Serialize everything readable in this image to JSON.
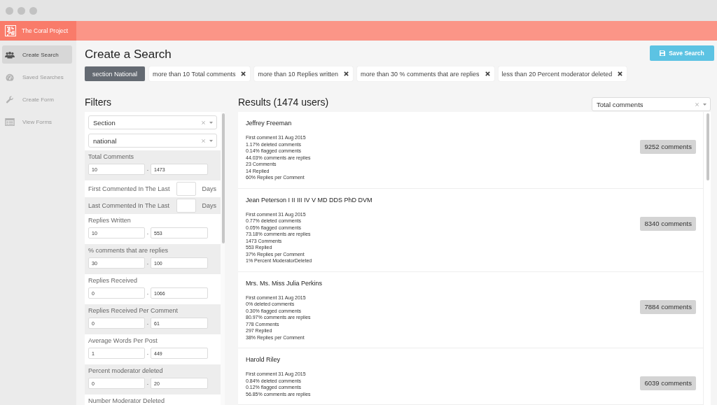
{
  "app": {
    "name": "The Coral Project"
  },
  "sidebar": {
    "items": [
      {
        "label": "Create Search",
        "selected": true
      },
      {
        "label": "Saved Searches",
        "selected": false
      },
      {
        "label": "Create Form",
        "selected": false
      },
      {
        "label": "View Forms",
        "selected": false
      }
    ]
  },
  "page": {
    "title": "Create a Search",
    "save_button": "Save Search"
  },
  "active_filters": [
    {
      "kind": "section",
      "label": "section National"
    },
    {
      "kind": "condition",
      "label": "more than 10 Total comments"
    },
    {
      "kind": "condition",
      "label": "more than 10 Replies written"
    },
    {
      "kind": "condition",
      "label": "more than 30 % comments that are replies"
    },
    {
      "kind": "condition",
      "label": "less than 20 Percent moderator deleted"
    }
  ],
  "filters": {
    "title": "Filters",
    "selects": [
      {
        "value": "Section"
      },
      {
        "value": "national"
      }
    ],
    "groups": [
      {
        "kind": "range",
        "label": "Total Comments",
        "min": "10",
        "separator": "-",
        "max": "1473"
      },
      {
        "kind": "days",
        "label": "First Commented In The Last",
        "unit": "Days"
      },
      {
        "kind": "days",
        "label": "Last Commented In The Last",
        "unit": "Days"
      },
      {
        "kind": "range",
        "label": "Replies Written",
        "min": "10",
        "separator": "-",
        "max": "553"
      },
      {
        "kind": "range",
        "label": "% comments that are replies",
        "min": "30",
        "separator": "-",
        "max": "100"
      },
      {
        "kind": "range",
        "label": "Replies Received",
        "min": "0",
        "separator": "-",
        "max": "1066"
      },
      {
        "kind": "range",
        "label": "Replies Received Per Comment",
        "min": "0",
        "separator": "-",
        "max": "61"
      },
      {
        "kind": "range",
        "label": "Average Words Per Post",
        "min": "1",
        "separator": "-",
        "max": "449"
      },
      {
        "kind": "range",
        "label": "Percent moderator deleted",
        "min": "0",
        "separator": "-",
        "max": "20"
      },
      {
        "kind": "range",
        "label": "Number Moderator Deleted"
      }
    ]
  },
  "results": {
    "title": "Results (1474 users)",
    "sort": {
      "value": "Total comments"
    },
    "users": [
      {
        "name": "Jeffrey Freeman",
        "stats": [
          "First comment 31 Aug 2015",
          "1.17% deleted comments",
          "0.14% flagged comments",
          "44.03% comments are replies",
          "23 Comments",
          "14 Replied",
          "60% Replies per Comment"
        ],
        "count": "9252 comments"
      },
      {
        "name": "Jean Peterson I II III IV V MD DDS PhD DVM",
        "stats": [
          "First comment 31 Aug 2015",
          "0.77% deleted comments",
          "0.05% flagged comments",
          "73.18% comments are replies",
          "1473 Comments",
          "553 Replied",
          "37% Replies per Comment",
          "1% Percent ModeratorDeleted"
        ],
        "count": "8340 comments"
      },
      {
        "name": "Mrs. Ms. Miss Julia Perkins",
        "stats": [
          "First comment 31 Aug 2015",
          "0% deleted comments",
          "0.30% flagged comments",
          "80.97% comments are replies",
          "778 Comments",
          "297 Replied",
          "38% Replies per Comment"
        ],
        "count": "7884 comments"
      },
      {
        "name": "Harold Riley",
        "stats": [
          "First comment 31 Aug 2015",
          "0.84% deleted comments",
          "0.12% flagged comments",
          "56.85% comments are replies"
        ],
        "count": "6039 comments"
      }
    ]
  }
}
